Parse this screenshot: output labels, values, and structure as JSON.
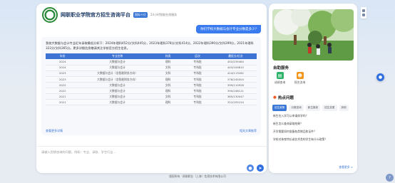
{
  "header": {
    "title": "网联职业学院官方招生咨询平台",
    "tag": "国际十亿",
    "subtitle": "24小时智能在线服务"
  },
  "chat": {
    "user_question": "你们学校大数据与会计专业分数是多少?",
    "answer_text": "我校大数据与会计专业近年录取最低分如下：2024年理科452分/文科445分，2023年理科378分/文科414分，2022年理科390分/文科399分，2021年理科322分/文科365分。更多详细信息敬请关注学校官方招生信息。",
    "columns": [
      "年份",
      "专业名称",
      "科类",
      "层次",
      "最低分/位次"
    ],
    "rows": [
      [
        "2024",
        "大数据与会计",
        "理科",
        "专科批",
        "452/235464"
      ],
      [
        "2024",
        "大数据与会计",
        "文科",
        "专科批",
        "445/109815"
      ],
      [
        "2023",
        "大数据与会计（含智能财务方向）",
        "文科",
        "专科批",
        "414/113262"
      ],
      [
        "2023",
        "大数据与会计（含智能财务方向）",
        "理科",
        "专科批",
        "378/245004"
      ],
      [
        "2022",
        "大数据与会计",
        "文科",
        "专科批",
        "399/110928"
      ],
      [
        "2022",
        "大数据与会计",
        "理科",
        "专科批",
        "390/248121"
      ],
      [
        "2021",
        "大数据与会计",
        "文科",
        "专科批",
        "365/130047"
      ],
      [
        "2021",
        "大数据与会计",
        "理科",
        "专科批",
        "322/255154"
      ]
    ],
    "view_more": "查看更多详情",
    "related_link": "相关文章推荐"
  },
  "input": {
    "placeholder": "请输入您想咨询的问题，例如：专业、录取、学生行业..."
  },
  "sidebar": {
    "services_title": "自助服务",
    "services": [
      {
        "label": "成绩查询",
        "icon": "chart-icon",
        "color": "#2fb36b"
      },
      {
        "label": "报名咨询",
        "icon": "user-icon",
        "color": "#f2961f"
      }
    ],
    "hot_title": "热点问题",
    "tabs": [
      "招生政策",
      "分数查询",
      "新生报到",
      "招生变更",
      "其他"
    ],
    "questions": [
      "新生在入学可以申请休学吗？",
      "新生怎么查询录取结果？",
      "开学需要如何准备各类物品和证件？",
      "学校对体育特长或艺术类的学生有什么政策？"
    ],
    "more": "查看更多 >"
  },
  "footer": {
    "text": "版权所有 · 网联职业（上海）信息技术有限公司"
  }
}
